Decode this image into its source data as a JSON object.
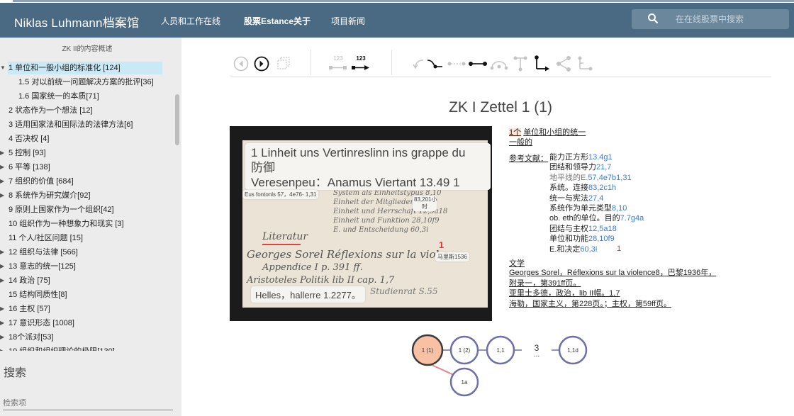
{
  "header": {
    "brand": "Niklas Luhmann档案馆",
    "nav": [
      "人员和工作在线",
      "股票Estance关于",
      "项目新闻"
    ],
    "search_placeholder": "在在线股票中搜索"
  },
  "sidebar": {
    "title": "ZK II的内容概述",
    "items": [
      {
        "label": "1 单位和一般小组的标准化 [124]",
        "arrow": "▼",
        "indent": 0,
        "selected": true
      },
      {
        "label": "1.5 对以前统一问题解决方案的批评[36]",
        "arrow": "",
        "indent": 1
      },
      {
        "label": "1.6 国家统一的本质[71]",
        "arrow": "",
        "indent": 1
      },
      {
        "label": "2 状态作为一个想法 [12]",
        "arrow": "",
        "indent": 0
      },
      {
        "label": "3 适用国家法和国际法的法律方法[6]",
        "arrow": "",
        "indent": 0
      },
      {
        "label": "4 否决权 [4]",
        "arrow": "",
        "indent": 0
      },
      {
        "label": "5 控制 [93]",
        "arrow": "▶",
        "indent": 0
      },
      {
        "label": "6 平等 [138]",
        "arrow": "▶",
        "indent": 0
      },
      {
        "label": "7 组织的价值 [684]",
        "arrow": "▶",
        "indent": 0
      },
      {
        "label": "8 系统作为研究媒介[92]",
        "arrow": "▶",
        "indent": 0
      },
      {
        "label": "9 原则上国家作为一个组织[42]",
        "arrow": "",
        "indent": 0
      },
      {
        "label": "10 组织作为一种想象力和现实 [3]",
        "arrow": "",
        "indent": 0
      },
      {
        "label": "11 个人/社区问题 [15]",
        "arrow": "",
        "indent": 0
      },
      {
        "label": "12 组织与法律 [566]",
        "arrow": "▶",
        "indent": 0
      },
      {
        "label": "13 意志的统一[125]",
        "arrow": "▶",
        "indent": 0
      },
      {
        "label": "14 政治 [75]",
        "arrow": "▶",
        "indent": 0
      },
      {
        "label": "15 结构同质性[8]",
        "arrow": "",
        "indent": 0
      },
      {
        "label": "16 主权 [57]",
        "arrow": "▶",
        "indent": 0
      },
      {
        "label": "17 意识形态 [1008]",
        "arrow": "▶",
        "indent": 0
      },
      {
        "label": "18个派对[53]",
        "arrow": "▶",
        "indent": 0
      },
      {
        "label": "19 组织和组织理论的极限[130]",
        "arrow": "▶",
        "indent": 0
      }
    ],
    "search_title": "搜索",
    "search_placeholder": "检索项"
  },
  "toolbar": {
    "num_a": "123",
    "num_b": "123"
  },
  "zettel": {
    "title": "ZK I Zettel 1 (1)"
  },
  "card": {
    "overlay_line1": "1 Linheit uns Vertinreslinn ins grappe du",
    "overlay_line2": "防御",
    "overlay_line3": "Veresenpeu：Anamus Viertant 13.49 1",
    "tag_left": "Eus fontonls 57，4e76- 1,31",
    "tag_hours_1": "83,201小",
    "tag_hours_2": "时",
    "tag_right": "马里斯1536",
    "bottom_overlay": "Helles，hallerre 1.2277。",
    "hand_literatur": "Literatur",
    "hand_1": "Georges Sorel  Réflexions sur la violence",
    "hand_2": "Appendice I  p. 391 ff.",
    "hand_3": "Aristoteles  Politik  lib II  cap. 1,7",
    "hand_4": "Studienrat  S.55",
    "hand_marker": "1",
    "hand_list": [
      "System als Einheitstypus 8,10",
      "Einheit der Mitglieder 7,7",
      "Einheit und Herrschaft 12,5a18",
      "Einheit und Funktion 28,10f9",
      "E. und Entscheidung 60,3i"
    ]
  },
  "meta": {
    "heading_num": "1个",
    "heading_line1": "单位和小组的统一",
    "heading_line2": "一般的",
    "refs_label": "参考文献：",
    "refs": [
      {
        "text": "能力正方形",
        "link": "13.4g1",
        "muted": false
      },
      {
        "text": "团结和领导力",
        "link": "21,7",
        "muted": false
      },
      {
        "text": "地平线的E.",
        "link": "57,4e7b1,31",
        "muted": true
      },
      {
        "text": "系统。连接",
        "link": "83,2c1h",
        "muted": false
      },
      {
        "text": "统一与宪法",
        "link": "27,4",
        "muted": false
      },
      {
        "text": "系统作为单元类型",
        "link": "8,10",
        "muted": false
      },
      {
        "text": "ob. eth的单位。目的",
        "link": "7.7g4a",
        "muted": false
      },
      {
        "text": "团结与主权",
        "link": "12,5a18",
        "muted": false
      },
      {
        "text": "单位和功能",
        "link": "28,10f9",
        "muted": false
      },
      {
        "text": "E.和决定",
        "link": "60,3i",
        "muted": false
      }
    ],
    "refs_marker": "1",
    "lit_label": "文学",
    "lit": [
      "Georges Sorel，Réflexions sur la violence8，巴黎1936年，",
      "附录一，第391ff页。",
      "亚里士多德，政治，lib II帽。1,7",
      "海勒，国家主义，第228页。；主权，第59ff页。"
    ]
  },
  "graph": {
    "nodes": [
      "1 (1)",
      "1 (2)",
      "1,1",
      "3",
      "1,1d",
      "1a"
    ],
    "ellipsis": "..."
  },
  "colors": {
    "header_bg": "#4a6a83",
    "link": "#3b7bd8",
    "node_current_fill": "#f9c1a4",
    "node_current_stroke": "#3a3a3a",
    "node_stroke": "#6e6fa8",
    "edge_branch": "#e88888"
  }
}
